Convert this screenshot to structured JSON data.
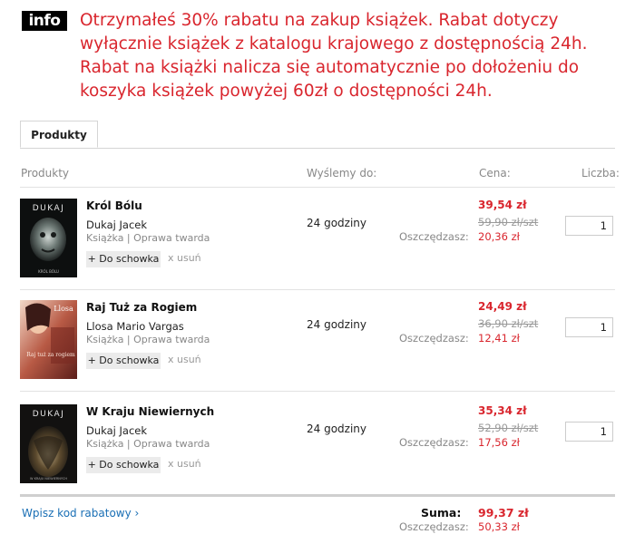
{
  "notice": {
    "badge": "info",
    "text": "Otrzymałeś 30% rabatu na zakup książek. Rabat dotyczy wyłącznie książek z katalogu krajowego z dostępnością 24h. Rabat na książki nalicza się automatycznie po dołożeniu do koszyka książek powyżej 60zł o dostępności 24h."
  },
  "tabs": [
    {
      "label": "Produkty"
    }
  ],
  "columns": {
    "products": "Produkty",
    "ship": "Wyślemy do:",
    "price": "Cena:",
    "qty": "Liczba:"
  },
  "items": [
    {
      "cover_text": "DUKAJ",
      "cover_sub": "KRÓL BÓLU",
      "title": "Król Bólu",
      "author": "Dukaj Jacek",
      "format": "Książka  | Oprawa twarda",
      "ship": "24 godziny",
      "save_label": "Oszczędzasz:",
      "price": "39,54 zł",
      "old_price": "59,90 zł/szt",
      "savings": "20,36 zł",
      "qty": "1",
      "schowek": "+ Do schowka",
      "remove": "x  usuń"
    },
    {
      "cover_text": "Llosa",
      "cover_sub": "Raj tuż za rogiem",
      "title": "Raj Tuż za Rogiem",
      "author": "Llosa Mario Vargas",
      "format": "Książka  | Oprawa twarda",
      "ship": "24 godziny",
      "save_label": "Oszczędzasz:",
      "price": "24,49 zł",
      "old_price": "36,90 zł/szt",
      "savings": "12,41 zł",
      "qty": "1",
      "schowek": "+ Do schowka",
      "remove": "x  usuń"
    },
    {
      "cover_text": "DUKAJ",
      "cover_sub": "W KRAJU NIEWIERNYCH",
      "title": "W Kraju Niewiernych",
      "author": "Dukaj Jacek",
      "format": "Książka  | Oprawa twarda",
      "ship": "24 godziny",
      "save_label": "Oszczędzasz:",
      "price": "35,34 zł",
      "old_price": "52,90 zł/szt",
      "savings": "17,56 zł",
      "qty": "1",
      "schowek": "+ Do schowka",
      "remove": "x  usuń"
    }
  ],
  "footer": {
    "rabat_link": "Wpisz kod rabatowy ›",
    "sum_label": "Suma:",
    "sum_value": "99,37 zł",
    "save_label": "Oszczędzasz:",
    "save_value": "50,33 zł"
  },
  "colors": {
    "accent": "#d9262e",
    "link": "#1a6fb5",
    "badge_bg": "#000000"
  }
}
